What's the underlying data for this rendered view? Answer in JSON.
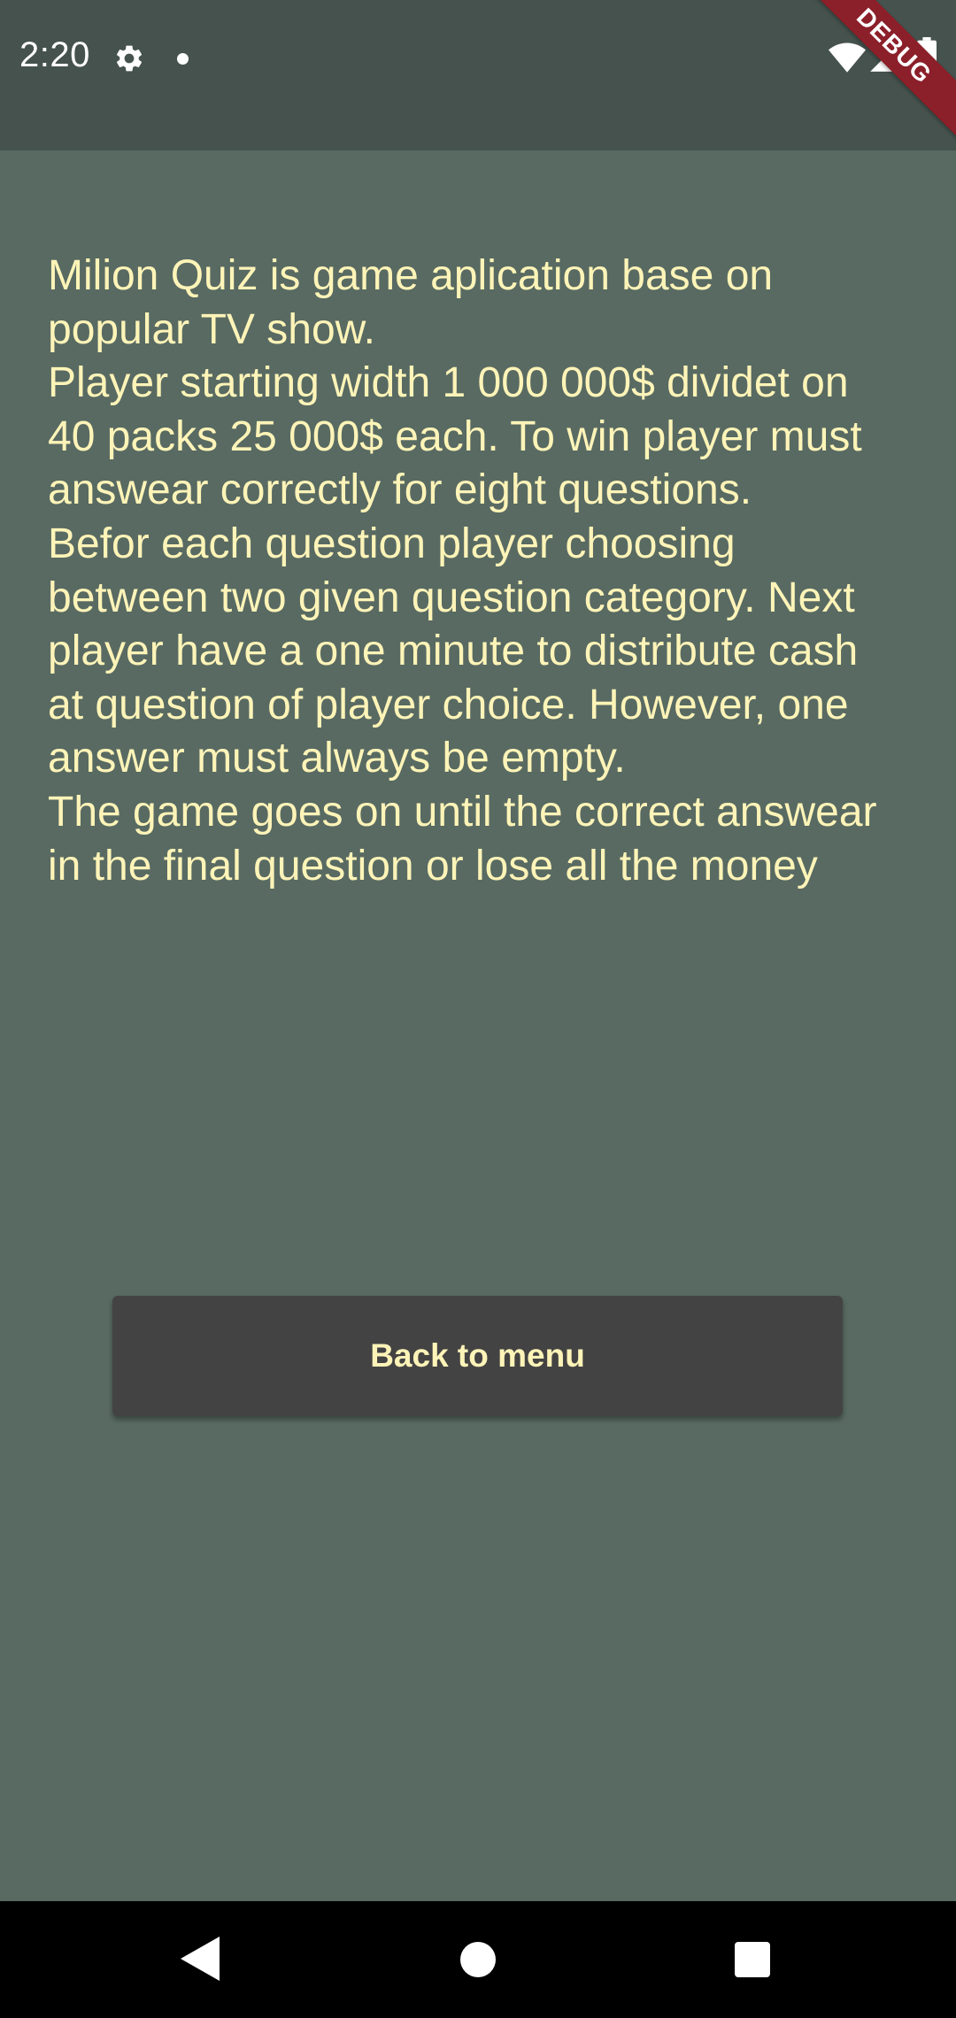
{
  "status_bar": {
    "time": "2:20",
    "debug_label": "DEBUG",
    "icons": [
      "gear-icon",
      "notification-dot-icon",
      "wifi-icon",
      "signal-icon",
      "battery-icon"
    ]
  },
  "content": {
    "paragraphs": [
      "Milion Quiz is game aplication base on popular TV show.",
      "Player starting width 1 000 000$ dividet on 40 packs 25 000$ each. To win player must answear correctly for eight questions.",
      "Befor each question player choosing between two given question category. Next player have a one minute to distribute cash at question of player choice. However, one answer must always be empty.",
      "The game goes on until the correct answear in the final question or lose all the money"
    ],
    "back_button_label": "Back to menu"
  },
  "nav_bar": {
    "icons": [
      "back-icon",
      "home-icon",
      "recents-icon"
    ]
  },
  "colors": {
    "background": "#586a62",
    "status_bar": "#45524d",
    "text": "#fff4b8",
    "button": "#444343",
    "debug_banner": "#8b1f2a"
  }
}
